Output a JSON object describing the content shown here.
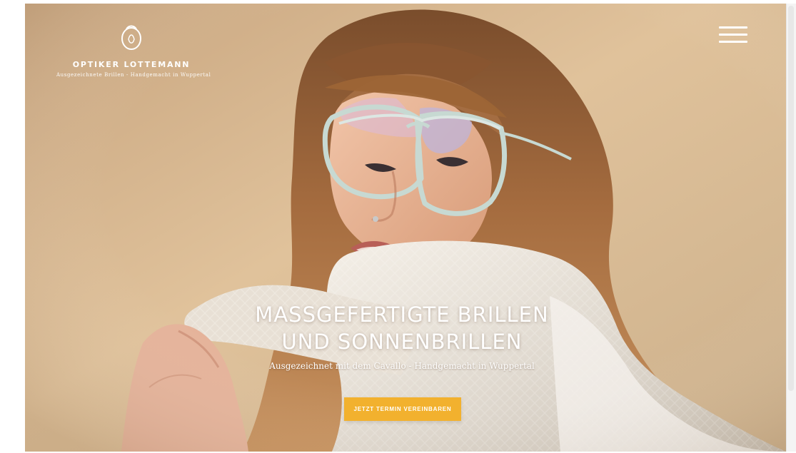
{
  "brand": {
    "name": "OPTIKER LOTTEMANN",
    "tagline": "Ausgezeichnete Brillen - Handgemacht in Wuppertal"
  },
  "navigation": {
    "menu_icon": "hamburger-menu-icon"
  },
  "hero": {
    "headline_line_1": "MASSGEFERTIGTE BRILLEN",
    "headline_line_2": "UND SONNENBRILLEN",
    "subline": "Ausgezeichnet mit dem Cavallo - Handgemacht in Wuppertal",
    "cta_label": "JETZT TERMIN VEREINBAREN"
  },
  "colors": {
    "hero_background": "#d8b992",
    "button_accent": "#f2b12e",
    "text": "#ffffff"
  },
  "icons": {
    "logo": "oval-monogram-logo-icon",
    "menu": "hamburger-menu-icon"
  }
}
